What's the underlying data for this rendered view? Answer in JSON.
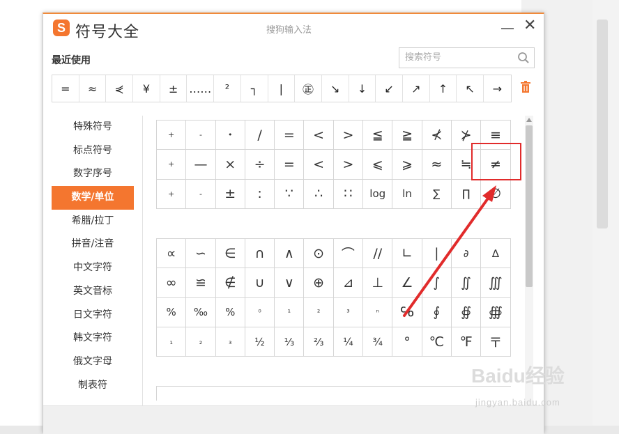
{
  "window": {
    "logo_letter": "S",
    "title": "符号大全",
    "subtitle": "搜狗输入法",
    "minimize": "—",
    "close": "✕"
  },
  "recent": {
    "label": "最近使用",
    "symbols": [
      "=",
      "≈",
      "⋞",
      "¥",
      "±",
      "……",
      "²",
      "┐",
      "|",
      "㊣",
      "↘",
      "↓",
      "↙",
      "↗",
      "↑",
      "↖",
      "→"
    ]
  },
  "search": {
    "placeholder": "搜索符号"
  },
  "sidebar": {
    "items": [
      {
        "label": "特殊符号"
      },
      {
        "label": "标点符号"
      },
      {
        "label": "数字序号"
      },
      {
        "label": "数学/单位"
      },
      {
        "label": "希腊/拉丁"
      },
      {
        "label": "拼音/注音"
      },
      {
        "label": "中文字符"
      },
      {
        "label": "英文音标"
      },
      {
        "label": "日文字符"
      },
      {
        "label": "韩文字符"
      },
      {
        "label": "俄文字母"
      },
      {
        "label": "制表符"
      }
    ],
    "active_index": 3
  },
  "grid_a": [
    "+",
    "-",
    "•",
    "/",
    "=",
    "<",
    ">",
    "≦",
    "≧",
    "⊀",
    "⊁",
    "≡",
    "+",
    "—",
    "×",
    "÷",
    "=",
    "<",
    ">",
    "⩽",
    "⩾",
    "≈",
    "≒",
    "≠",
    "+",
    "-",
    "±",
    ":",
    "∵",
    "∴",
    "∷",
    "log",
    "ln",
    "∑",
    "∏",
    "∅"
  ],
  "grid_b": [
    "∝",
    "∽",
    "∈",
    "∩",
    "∧",
    "⊙",
    "⌒",
    "//",
    "∟",
    "∣",
    "∂",
    "∆",
    "∞",
    "≌",
    "∉",
    "∪",
    "∨",
    "⊕",
    "⊿",
    "⊥",
    "∠",
    "∫",
    "∬",
    "∭",
    "%",
    "‰",
    "%",
    "⁰",
    "¹",
    "²",
    "³",
    "ⁿ",
    "℅",
    "∮",
    "∯",
    "∰",
    "₁",
    "₂",
    "₃",
    "½",
    "⅓",
    "⅔",
    "¼",
    "¾",
    "°",
    "℃",
    "℉",
    "〒"
  ],
  "highlight": {
    "symbol": "≠",
    "color": "#e12b2b"
  },
  "watermark": {
    "brand": "Baidu经验",
    "url": "jingyan.baidu.com"
  },
  "colors": {
    "accent": "#f4762f",
    "annotation": "#e12b2b"
  }
}
